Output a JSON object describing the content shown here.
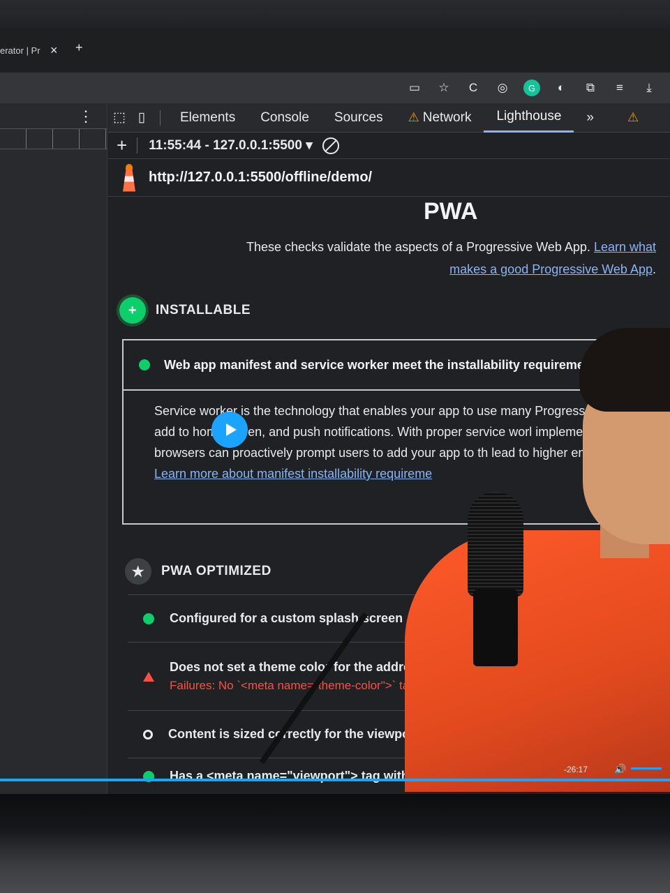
{
  "browser": {
    "tab_title": "erator | Pr",
    "tab_close": "×",
    "new_tab": "+"
  },
  "devtools": {
    "menu": "⋮",
    "tabs": [
      "Elements",
      "Console",
      "Sources",
      "Network",
      "Lighthouse"
    ],
    "more_tabs": "»",
    "network_warning": "⚠",
    "issues_warning": "⚠",
    "new_report": "+",
    "report_selector": "11:55:44 - 127.0.0.1:5500 ▾",
    "url": "http://127.0.0.1:5500/offline/demo/"
  },
  "report": {
    "title": "PWA",
    "description": "These checks validate the aspects of a Progressive Web App.",
    "description_link": "Learn what makes a good Progressive Web App",
    "description_end": ".",
    "installable": {
      "heading": "INSTALLABLE",
      "audit_title": "Web app manifest and service worker meet the installability requirements",
      "audit_body": "Service worker is the technology that enables your app to use many Progress as offline, add to homescreen, and push notifications. With proper service worl implementations, browsers can proactively prompt users to add your app to th lead to higher engagement.",
      "audit_link": "Learn more about manifest installability requireme"
    },
    "pwa_optimized": {
      "heading": "PWA OPTIMIZED",
      "audits": [
        {
          "title": "Configured for a custom splash screen",
          "status": "pass"
        },
        {
          "title": "Does not set a theme color for the address bar",
          "status": "fail",
          "failure": "Failures: No `<meta name=\"theme-color\">` tag found."
        },
        {
          "title": "Content is sized correctly for the viewport",
          "status": "info"
        },
        {
          "title": "Has a <meta name=\"viewport\"> tag with width",
          "status": "pass"
        }
      ]
    }
  },
  "video": {
    "time_remaining": "-26:17",
    "volume_icon": "🔊",
    "progress": 1.0
  },
  "colors": {
    "accent_blue": "#8ab4f8",
    "pass_green": "#0cce6b",
    "fail_red": "#ff4e42",
    "warning_orange": "#f29900"
  }
}
